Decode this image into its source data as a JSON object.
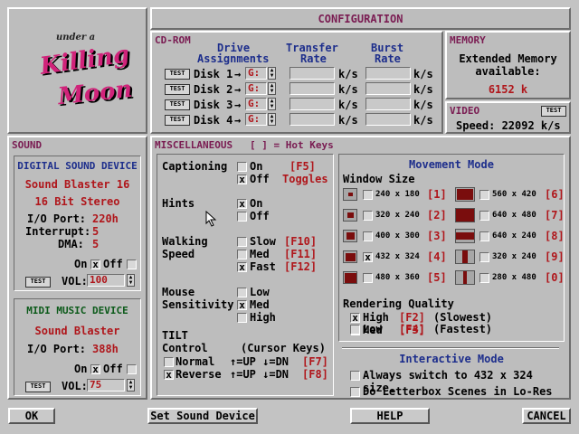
{
  "config_title": "CONFIGURATION",
  "logo_text": [
    "under a",
    "Killing",
    "Moon"
  ],
  "cdrom": {
    "title": "CD-ROM",
    "col_drive": "Drive",
    "col_assign": "Assignments",
    "col_transfer": "Transfer",
    "col_burst": "Burst",
    "col_rate": "Rate",
    "unit": "k/s",
    "test": "TEST",
    "disks": [
      {
        "label": "Disk 1",
        "drive": "G:"
      },
      {
        "label": "Disk 2",
        "drive": "G:"
      },
      {
        "label": "Disk 3",
        "drive": "G:"
      },
      {
        "label": "Disk 4",
        "drive": "G:"
      }
    ]
  },
  "memory": {
    "title": "MEMORY",
    "line1": "Extended Memory",
    "line2": "available:",
    "value": "6152 k"
  },
  "video": {
    "title": "VIDEO",
    "test": "TEST",
    "speed": "Speed: 22092 k/s"
  },
  "sound": {
    "title": "SOUND",
    "digital": {
      "title": "DIGITAL SOUND DEVICE",
      "name": "Sound Blaster 16",
      "mode": "16 Bit Stereo",
      "io_label": "I/O Port:",
      "io": "220h",
      "int_label": "Interrupt:",
      "int": "5",
      "dma_label": "DMA:",
      "dma": "5",
      "on": "On",
      "off": "Off",
      "test": "TEST",
      "vol_label": "VOL:",
      "vol": "100"
    },
    "midi": {
      "title": "MIDI MUSIC DEVICE",
      "name": "Sound Blaster",
      "io_label": "I/O Port:",
      "io": "388h",
      "on": "On",
      "off": "Off",
      "test": "TEST",
      "vol_label": "VOL:",
      "vol": "75"
    }
  },
  "misc": {
    "title": "MISCELLANEOUS",
    "hotkeys": "[ ] = Hot Keys",
    "captioning": "Captioning",
    "cap_on": "On",
    "cap_off": "Off",
    "cap_key": "[F5]",
    "cap_toggles": "Toggles",
    "hints": "Hints",
    "hints_on": "On",
    "hints_off": "Off",
    "walking1": "Walking",
    "walking2": "Speed",
    "slow": "Slow",
    "slow_key": "[F10]",
    "med": "Med",
    "med_key": "[F11]",
    "fast": "Fast",
    "fast_key": "[F12]",
    "mouse1": "Mouse",
    "mouse2": "Sensitivity",
    "low": "Low",
    "mmed": "Med",
    "high": "High",
    "tilt1": "TILT",
    "tilt2": "Control",
    "cursor": "(Cursor Keys)",
    "normal": "Normal",
    "normal_map": "↑=UP ↓=DN",
    "normal_key": "[F7]",
    "reverse": "Reverse",
    "reverse_map": "↑=UP ↓=DN",
    "reverse_key": "[F8]"
  },
  "movement": {
    "title": "Movement Mode",
    "window_size": "Window Size",
    "sizes_left": [
      {
        "label": "240 x 180",
        "key": "[1]",
        "checked": false
      },
      {
        "label": "320 x 240",
        "key": "[2]",
        "checked": false
      },
      {
        "label": "400 x 300",
        "key": "[3]",
        "checked": false
      },
      {
        "label": "432 x 324",
        "key": "[4]",
        "checked": true
      },
      {
        "label": "480 x 360",
        "key": "[5]",
        "checked": false
      }
    ],
    "sizes_right": [
      {
        "label": "560 x 420",
        "key": "[6]",
        "checked": false
      },
      {
        "label": "640 x 480",
        "key": "[7]",
        "checked": false
      },
      {
        "label": "640 x 240",
        "key": "[8]",
        "checked": false
      },
      {
        "label": "320 x 240",
        "key": "[9]",
        "checked": false
      },
      {
        "label": "280 x 480",
        "key": "[0]",
        "checked": false
      }
    ],
    "quality_title": "Rendering Quality",
    "high": "High",
    "high_key": "[F2]",
    "slowest": "(Slowest)",
    "med": "Med",
    "med_key": "[F3]",
    "low": "Low",
    "low_key": "[F4]",
    "fastest": "(Fastest)"
  },
  "interactive": {
    "title": "Interactive Mode",
    "opt1": "Always switch to 432 x 324 size.",
    "opt2": "Do Letterbox Scenes in Lo-Res"
  },
  "buttons": {
    "ok": "OK",
    "sound": "Set Sound Device",
    "help": "HELP",
    "cancel": "CANCEL"
  }
}
